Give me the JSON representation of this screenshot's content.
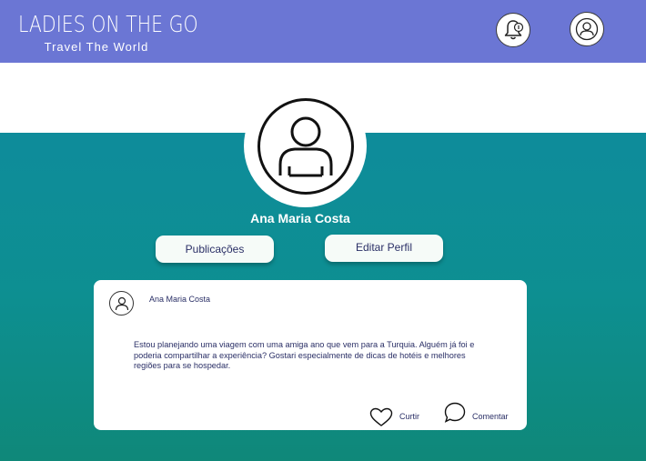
{
  "header": {
    "brand_title": "LADIES ON THE GO",
    "brand_subtitle": "Travel The World",
    "bell_icon": "bell-icon",
    "user_icon": "user-icon"
  },
  "profile": {
    "name": "Ana Maria Costa",
    "avatar_icon": "user-icon"
  },
  "tabs": {
    "posts_label": "Publicações",
    "edit_label": "Editar Perfil"
  },
  "post": {
    "author": "Ana Maria Costa",
    "text": "Estou planejando uma viagem com uma amiga ano que vem para a Turquia. Alguém já foi e poderia compartilhar a experiência? Gostari especialmente de dicas de hotéis e melhores regiões para se hospedar.",
    "like_label": "Curtir",
    "comment_label": "Comentar"
  },
  "colors": {
    "header": "#6b76d4",
    "hero_top": "#0e8c9b",
    "hero_bottom": "#0f8879",
    "text_dark": "#2a2f66"
  }
}
